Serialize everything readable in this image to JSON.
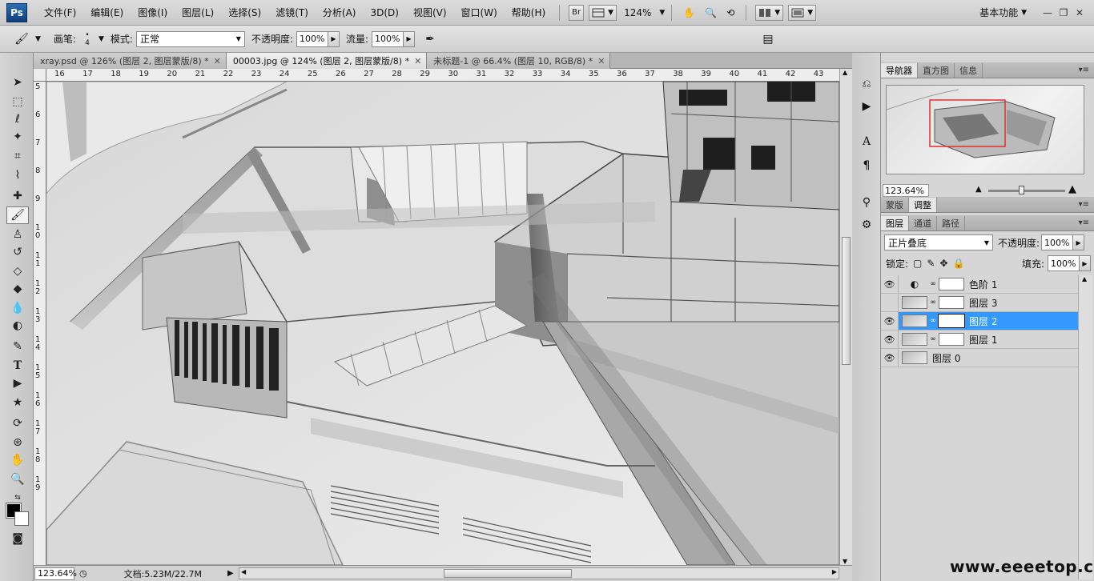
{
  "app": {
    "logo": "Ps"
  },
  "menu": [
    "文件(F)",
    "编辑(E)",
    "图像(I)",
    "图层(L)",
    "选择(S)",
    "滤镜(T)",
    "分析(A)",
    "3D(D)",
    "视图(V)",
    "窗口(W)",
    "帮助(H)"
  ],
  "menubar_extras": {
    "bridge": "Br",
    "zoom": "124%",
    "workspace": "基本功能"
  },
  "options": {
    "brush_label": "画笔:",
    "brush_size": "4",
    "mode_label": "模式:",
    "mode_value": "正常",
    "opacity_label": "不透明度:",
    "opacity_value": "100%",
    "flow_label": "流量:",
    "flow_value": "100%"
  },
  "tabs": [
    {
      "label": "xray.psd @ 126% (图层 2, 图层蒙版/8) *",
      "active": false
    },
    {
      "label": "00003.jpg @ 124% (图层 2, 图层蒙版/8) *",
      "active": true
    },
    {
      "label": "未标题-1 @ 66.4% (图层 10, RGB/8) *",
      "active": false
    }
  ],
  "ruler": {
    "top": [
      "16",
      "17",
      "18",
      "19",
      "20",
      "21",
      "22",
      "23",
      "24",
      "25",
      "26",
      "27",
      "28",
      "29",
      "30",
      "31",
      "32",
      "33",
      "34",
      "35",
      "36",
      "37",
      "38",
      "39",
      "40",
      "41",
      "42",
      "43"
    ],
    "left": [
      "5",
      "6",
      "7",
      "8",
      "9",
      "1 0",
      "1 1",
      "1 2",
      "1 3",
      "1 4",
      "1 5",
      "1 6",
      "1 7",
      "1 8",
      "1 9"
    ]
  },
  "status": {
    "zoom": "123.64%",
    "doc": "文档:5.23M/22.7M"
  },
  "navigator": {
    "tabs": [
      "导航器",
      "直方图",
      "信息"
    ],
    "zoom": "123.64%"
  },
  "adjust_tabs": [
    "蒙版",
    "调整"
  ],
  "layers_panel": {
    "tabs": [
      "图层",
      "通道",
      "路径"
    ],
    "blend_mode": "正片叠底",
    "opacity_label": "不透明度:",
    "opacity_value": "100%",
    "lock_label": "锁定:",
    "fill_label": "填充:",
    "fill_value": "100%",
    "layers": [
      {
        "name": "色阶 1",
        "visible": true,
        "type": "adjustment",
        "selected": false
      },
      {
        "name": "图层 3",
        "visible": false,
        "type": "masked",
        "selected": false
      },
      {
        "name": "图层 2",
        "visible": true,
        "type": "masked",
        "selected": true
      },
      {
        "name": "图层 1",
        "visible": true,
        "type": "masked",
        "selected": false
      },
      {
        "name": "图层 0",
        "visible": true,
        "type": "plain",
        "selected": false
      }
    ]
  },
  "watermark": "www.eeeetop.com"
}
